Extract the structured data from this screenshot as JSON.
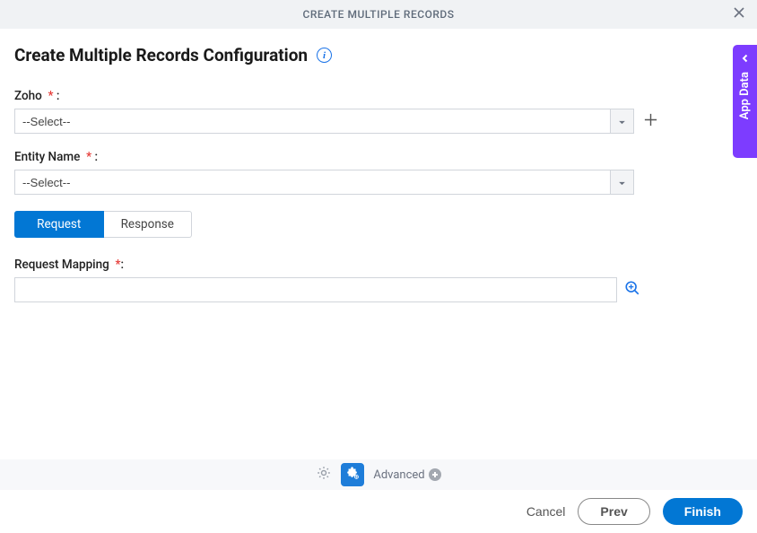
{
  "header": {
    "title": "CREATE MULTIPLE RECORDS"
  },
  "page": {
    "title": "Create Multiple Records Configuration"
  },
  "fields": {
    "zoho": {
      "label": "Zoho",
      "required_marker": "*",
      "colon": ":",
      "value": "--Select--"
    },
    "entity_name": {
      "label": "Entity Name",
      "required_marker": "*",
      "colon": ":",
      "value": "--Select--"
    },
    "request_mapping": {
      "label": "Request Mapping",
      "required_marker": "*",
      "colon": ":",
      "value": ""
    }
  },
  "tabs": {
    "request": "Request",
    "response": "Response"
  },
  "bottom": {
    "advanced": "Advanced"
  },
  "footer": {
    "cancel": "Cancel",
    "prev": "Prev",
    "finish": "Finish"
  },
  "side_panel": {
    "label": "App Data"
  }
}
